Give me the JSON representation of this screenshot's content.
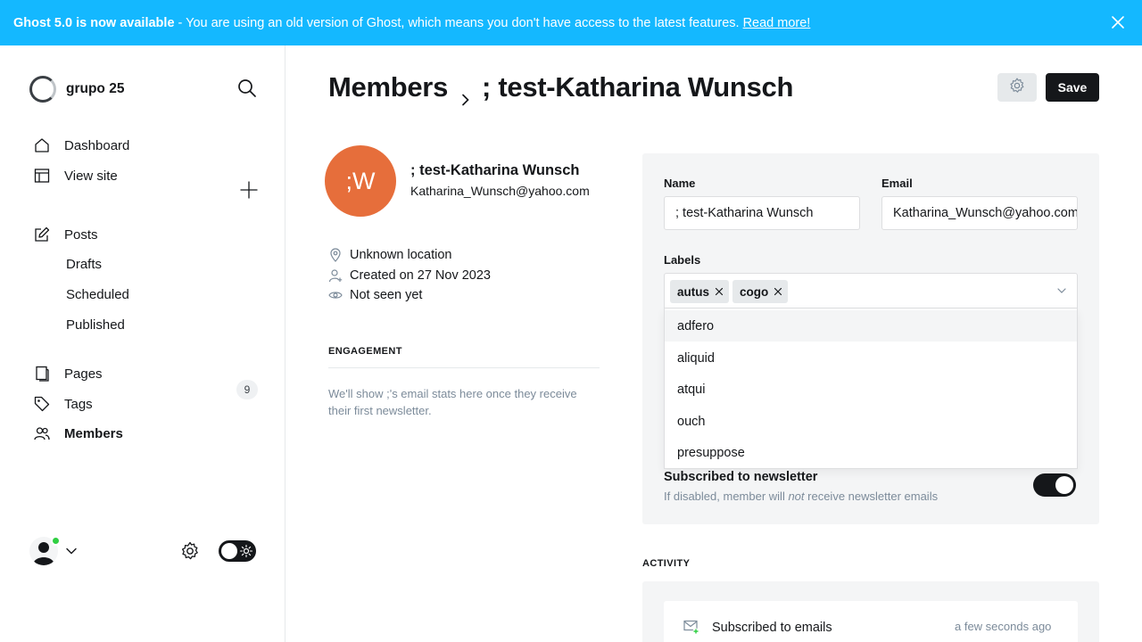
{
  "banner": {
    "title": "Ghost 5.0 is now available",
    "message": "- You are using an old version of Ghost, which means you don't have access to the latest features.",
    "link": "Read more!"
  },
  "sidebar": {
    "brand": "grupo 25",
    "nav": {
      "dashboard": "Dashboard",
      "view_site": "View site",
      "posts": "Posts",
      "drafts": "Drafts",
      "scheduled": "Scheduled",
      "published": "Published",
      "pages": "Pages",
      "tags": "Tags",
      "members": "Members",
      "members_count": "9"
    }
  },
  "header": {
    "breadcrumb_root": "Members",
    "breadcrumb_current": "; test-Katharina Wunsch",
    "save_label": "Save"
  },
  "member": {
    "initials": ";W",
    "name": "; test-Katharina Wunsch",
    "email": "Katharina_Wunsch@yahoo.com",
    "location": "Unknown location",
    "created": "Created on 27 Nov 2023",
    "seen": "Not seen yet"
  },
  "engagement": {
    "title": "ENGAGEMENT",
    "text": "We'll show ;'s email stats here once they receive their first newsletter."
  },
  "form": {
    "name_label": "Name",
    "name_value": ";   test-Katharina Wunsch",
    "email_label": "Email",
    "email_value": "Katharina_Wunsch@yahoo.com",
    "labels_label": "Labels",
    "tags": [
      "autus",
      "cogo"
    ],
    "options": [
      "adfero",
      "aliquid",
      "atqui",
      "ouch",
      "presuppose"
    ],
    "newsletter_title": "Subscribed to newsletter",
    "newsletter_desc_pre": "If disabled, member will ",
    "newsletter_desc_em": "not",
    "newsletter_desc_post": " receive newsletter emails",
    "newsletter_enabled": true
  },
  "activity": {
    "title": "ACTIVITY",
    "items": [
      {
        "text": "Subscribed to emails",
        "time": "a few seconds ago"
      }
    ]
  },
  "colors": {
    "banner": "#14b8ff",
    "avatar": "#e66e3b",
    "online": "#30cf43"
  }
}
